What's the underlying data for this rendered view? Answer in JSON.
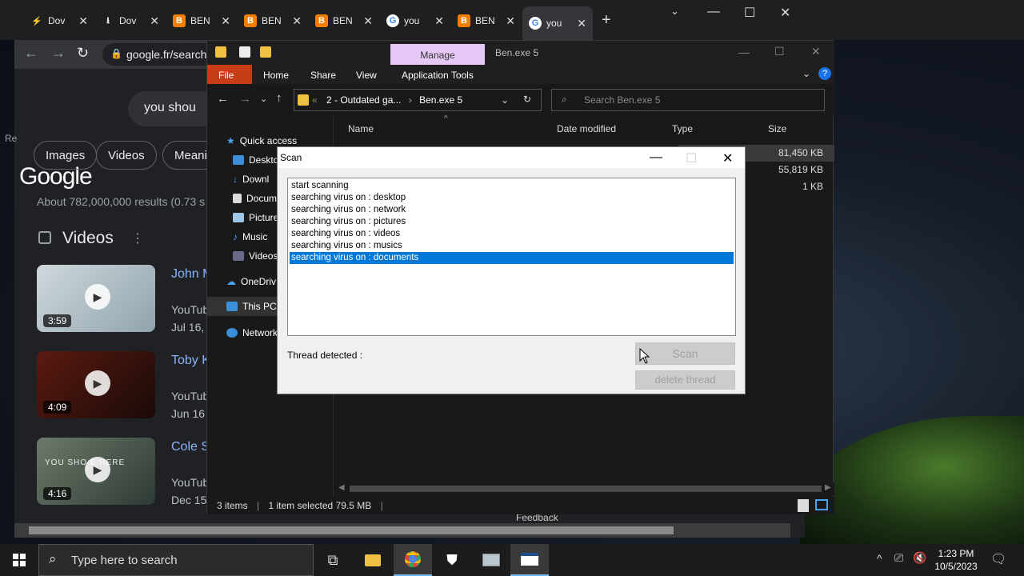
{
  "chrome": {
    "tabs": [
      {
        "label": "Dov",
        "icon": "lightning-icon"
      },
      {
        "label": "Dov",
        "icon": "download-icon"
      },
      {
        "label": "BEN",
        "icon": "blogger-icon"
      },
      {
        "label": "BEN",
        "icon": "blogger-icon"
      },
      {
        "label": "BEN",
        "icon": "blogger-icon"
      },
      {
        "label": "you",
        "icon": "google-icon"
      },
      {
        "label": "BEN",
        "icon": "blogger-icon"
      },
      {
        "label": "you",
        "icon": "google-icon",
        "active": true
      }
    ],
    "new_tab": "+",
    "url": "google.fr/search",
    "google_logo": "Google",
    "search_query": "you shou",
    "chips": [
      "Images",
      "Videos",
      "Meani"
    ],
    "results_count": "About 782,000,000 results (0.73 s",
    "side_letter": "Re",
    "videos_heading": "Videos",
    "videos": [
      {
        "title": "John M",
        "source": "YouTub",
        "date": "Jul 16,",
        "duration": "3:59"
      },
      {
        "title": "Toby K",
        "source": "YouTub",
        "date": "Jun 16",
        "duration": "4:09"
      },
      {
        "title": "Cole S",
        "source": "YouTub",
        "date": "Dec 15",
        "duration": "4:16",
        "overlay_text": "YOU SHO   E HERE"
      }
    ],
    "feedback": "Feedback"
  },
  "explorer": {
    "manage": "Manage",
    "title": "Ben.exe 5",
    "ribbon": [
      "File",
      "Home",
      "Share",
      "View",
      "Application Tools"
    ],
    "address": {
      "parent": "2 - Outdated ga...",
      "current": "Ben.exe 5"
    },
    "search_placeholder": "Search Ben.exe 5",
    "nav": [
      "Quick access",
      "Deskto",
      "Downl",
      "Docum",
      "Picture",
      "Music",
      "Videos",
      "OneDriv",
      "This PC",
      "Network"
    ],
    "columns": [
      "Name",
      "Date modified",
      "Type",
      "Size"
    ],
    "sizes": [
      "81,450 KB",
      "55,819 KB",
      "1 KB"
    ],
    "status": {
      "items": "3 items",
      "selected": "1 item selected  79.5 MB"
    }
  },
  "scan_dialog": {
    "title": "Scan",
    "log": [
      "start scanning",
      "searching virus on : desktop",
      "searching virus on : network",
      "searching virus on : pictures",
      "searching virus on : videos",
      "searching virus on : musics",
      "searching virus on : documents"
    ],
    "selected_index": 6,
    "thread_label": "Thread detected :",
    "scan_button": "Scan",
    "delete_button": "delete thread"
  },
  "taskbar": {
    "search_placeholder": "Type here to search",
    "time": "1:23 PM",
    "date": "10/5/2023"
  },
  "colors": {
    "accent": "#0078d7",
    "file_tab": "#c63d15",
    "manage_tab": "#e5c8f5",
    "chrome_link": "#8ab4f8"
  }
}
